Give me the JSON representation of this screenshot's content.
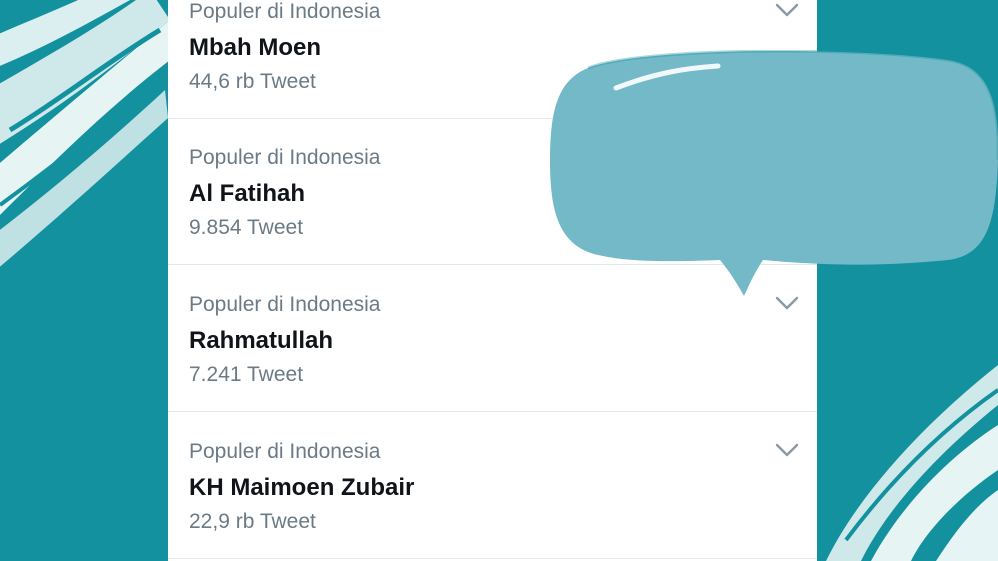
{
  "trends": [
    {
      "context": "Populer di Indonesia",
      "name": "Mbah Moen",
      "count": "44,6 rb Tweet",
      "menu_icon": "chevron-down-icon"
    },
    {
      "context": "Populer di Indonesia",
      "name": "Al Fatihah",
      "count": "9.854 Tweet",
      "menu_icon": "chevron-down-icon"
    },
    {
      "context": "Populer di Indonesia",
      "name": "Rahmatullah",
      "count": "7.241 Tweet",
      "menu_icon": "chevron-down-icon"
    },
    {
      "context": "Populer di Indonesia",
      "name": "KH Maimoen Zubair",
      "count": "22,9 rb Tweet",
      "menu_icon": "chevron-down-icon"
    }
  ],
  "colors": {
    "background": "#13919e",
    "panel": "#ffffff",
    "bubble": "#74b9c8",
    "brush": "#cfe9ea",
    "secondary_text": "#6b7a86",
    "primary_text": "#101418",
    "divider": "#e3e8eb"
  }
}
